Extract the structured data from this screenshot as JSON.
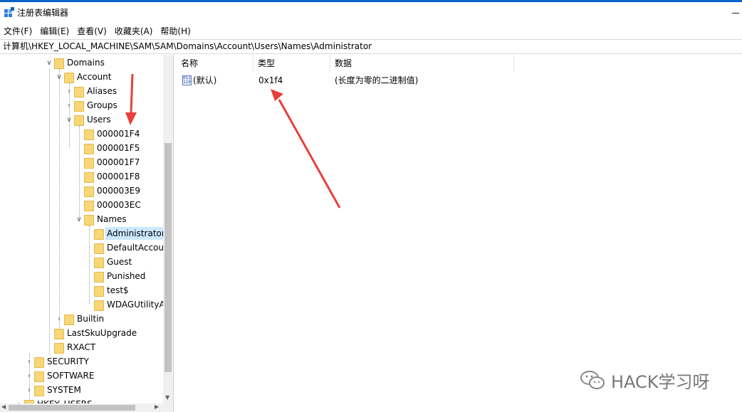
{
  "window": {
    "title": "注册表编辑器",
    "icon": "regedit-icon"
  },
  "menu": [
    "文件(F)",
    "编辑(E)",
    "查看(V)",
    "收藏夹(A)",
    "帮助(H)"
  ],
  "address": "计算机\\HKEY_LOCAL_MACHINE\\SAM\\SAM\\Domains\\Account\\Users\\Names\\Administrator",
  "tree": {
    "items": [
      {
        "label": "Domains",
        "expander": "open"
      },
      {
        "label": "Account",
        "expander": "open"
      },
      {
        "label": "Aliases",
        "expander": "closed"
      },
      {
        "label": "Groups",
        "expander": "closed"
      },
      {
        "label": "Users",
        "expander": "open"
      },
      {
        "label": "000001F4",
        "expander": "none"
      },
      {
        "label": "000001F5",
        "expander": "none"
      },
      {
        "label": "000001F7",
        "expander": "none"
      },
      {
        "label": "000001F8",
        "expander": "none"
      },
      {
        "label": "000003E9",
        "expander": "none"
      },
      {
        "label": "000003EC",
        "expander": "none"
      },
      {
        "label": "Names",
        "expander": "open"
      },
      {
        "label": "Administrator",
        "expander": "none",
        "selected": true
      },
      {
        "label": "DefaultAccount",
        "expander": "none"
      },
      {
        "label": "Guest",
        "expander": "none"
      },
      {
        "label": "Punished",
        "expander": "none"
      },
      {
        "label": "test$",
        "expander": "none"
      },
      {
        "label": "WDAGUtilityAccount",
        "expander": "none"
      },
      {
        "label": "Builtin",
        "expander": "closed"
      },
      {
        "label": "LastSkuUpgrade",
        "expander": "none"
      },
      {
        "label": "RXACT",
        "expander": "none"
      },
      {
        "label": "SECURITY",
        "expander": "closed"
      },
      {
        "label": "SOFTWARE",
        "expander": "closed"
      },
      {
        "label": "SYSTEM",
        "expander": "closed"
      },
      {
        "label": "HKEY_USERS",
        "expander": "closed"
      }
    ]
  },
  "list": {
    "columns": [
      "名称",
      "类型",
      "数据"
    ],
    "rows": [
      {
        "name": "(默认)",
        "type": "0x1f4",
        "data": "(长度为零的二进制值)",
        "icon": "binary-value-icon"
      }
    ]
  },
  "annotation_color": "#e8403a",
  "selection_color": "#cce8ff",
  "accent_color": "#0a64c8",
  "watermark": "HACK学习呀"
}
